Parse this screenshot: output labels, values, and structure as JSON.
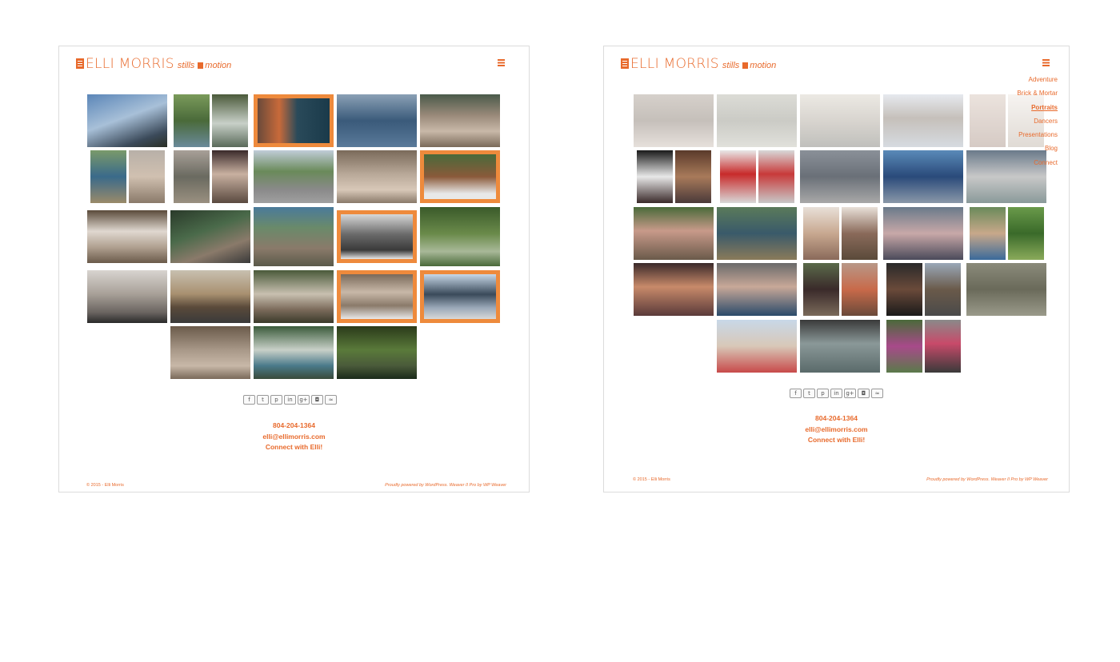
{
  "site": {
    "brand_name": "ELLI MORRIS",
    "brand_tag_a": "stills",
    "brand_tag_b": "motion"
  },
  "menu": {
    "items": [
      "Adventure",
      "Brick & Mortar",
      "Portraits",
      "Dancers",
      "Presentations",
      "Blog",
      "Connect"
    ],
    "active": "Portraits"
  },
  "share": [
    "f",
    "t",
    "p",
    "in",
    "g+",
    "◘",
    "≈"
  ],
  "contact": {
    "phone": "804-204-1364",
    "email": "elli@ellimorris.com",
    "connect": "Connect with Elli!"
  },
  "footer": {
    "copyright": "© 2015 - Elli Morris",
    "powered": "Proudly powered by WordPress. Weaver II Pro by WP Weaver"
  },
  "colors": {
    "accent": "#e86a2c",
    "feature_frame": "#ee8a3c"
  }
}
